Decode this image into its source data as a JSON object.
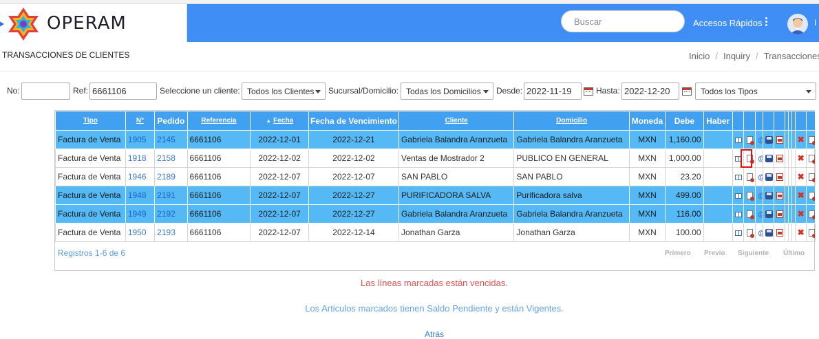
{
  "app": {
    "logo_text": "OPERAM",
    "search_placeholder": "Buscar",
    "quick_access": "Accesos Rápidos",
    "user_initial": "I"
  },
  "page": {
    "title": "TRANSACCIONES DE CLIENTES",
    "breadcrumb": [
      "Inicio",
      "Inquiry",
      "Transacciones"
    ]
  },
  "filters": {
    "no_label": "No:",
    "no_value": "",
    "ref_label": "Ref:",
    "ref_value": "6661106",
    "client_label": "Seleccione un cliente:",
    "client_value": "Todos los Clientes",
    "branch_label": "Sucursal/Domicilio:",
    "branch_value": "Todas los Domicilios",
    "from_label": "Desde:",
    "from_value": "2022-11-19",
    "to_label": "Hasta:",
    "to_value": "2022-12-20",
    "type_value": "Todos los Tipos"
  },
  "table": {
    "headers": {
      "tipo": "Tipo",
      "numero": "N°",
      "pedido": "Pedido",
      "referencia": "Referencia",
      "fecha": "Fecha",
      "vencimiento": "Fecha de Vencimiento",
      "cliente": "Cliente",
      "domicilio": "Domicilio",
      "moneda": "Moneda",
      "debe": "Debe",
      "haber": "Haber"
    },
    "rows": [
      {
        "tipo": "Factura de Venta",
        "numero": "1905",
        "pedido": "2145",
        "referencia": "6661106",
        "fecha": "2022-12-01",
        "vencimiento": "2022-12-21",
        "cliente": "Gabriela Balandra Aranzueta",
        "domicilio": "Gabriela Balandra Aranzueta",
        "moneda": "MXN",
        "debe": "1,160.00",
        "haber": "",
        "highlighted": true
      },
      {
        "tipo": "Factura de Venta",
        "numero": "1918",
        "pedido": "2158",
        "referencia": "6661106",
        "fecha": "2022-12-02",
        "vencimiento": "2022-12-02",
        "cliente": "Ventas de Mostrador 2",
        "domicilio": "PUBLICO EN GENERAL",
        "moneda": "MXN",
        "debe": "1,000.00",
        "haber": "",
        "highlighted": false
      },
      {
        "tipo": "Factura de Venta",
        "numero": "1946",
        "pedido": "2189",
        "referencia": "6661106",
        "fecha": "2022-12-07",
        "vencimiento": "2022-12-07",
        "cliente": "SAN PABLO",
        "domicilio": "SAN PABLO",
        "moneda": "MXN",
        "debe": "23.20",
        "haber": "",
        "highlighted": false
      },
      {
        "tipo": "Factura de Venta",
        "numero": "1948",
        "pedido": "2191",
        "referencia": "6661106",
        "fecha": "2022-12-07",
        "vencimiento": "2022-12-27",
        "cliente": "PURIFICADORA SALVA",
        "domicilio": "Purificadora salva",
        "moneda": "MXN",
        "debe": "499.00",
        "haber": "",
        "highlighted": true
      },
      {
        "tipo": "Factura de Venta",
        "numero": "1949",
        "pedido": "2192",
        "referencia": "6661106",
        "fecha": "2022-12-07",
        "vencimiento": "2022-12-27",
        "cliente": "Gabriela Balandra Aranzueta",
        "domicilio": "Gabriela Balandra Aranzueta",
        "moneda": "MXN",
        "debe": "116.00",
        "haber": "",
        "highlighted": true
      },
      {
        "tipo": "Factura de Venta",
        "numero": "1950",
        "pedido": "2193",
        "referencia": "6661106",
        "fecha": "2022-12-07",
        "vencimiento": "2022-12-14",
        "cliente": "Jonathan Garza",
        "domicilio": "Jonathan Garza",
        "moneda": "MXN",
        "debe": "100.00",
        "haber": "",
        "highlighted": false
      }
    ],
    "row_actions": [
      "book-icon",
      "document-icon",
      "email-icon",
      "save-icon",
      "pdf-icon",
      "delete-icon",
      "document-icon"
    ],
    "records_text": "Registros 1-6 de 6",
    "pager": {
      "first": "Primero",
      "prev": "Previo",
      "next": "Siguiente",
      "last": "Último"
    }
  },
  "messages": {
    "overdue": "Las líneas marcadas están vencidas.",
    "pending": "Los Articulos marcados tienen Saldo Pendiente y están Vigentes.",
    "back": "Atrás"
  },
  "colors": {
    "header_bg": "#3f8ef5",
    "table_header": "#41a0f0",
    "row_highlight": "#54b9f5",
    "overdue_text": "#e05252",
    "pending_text": "#63a4e8"
  }
}
